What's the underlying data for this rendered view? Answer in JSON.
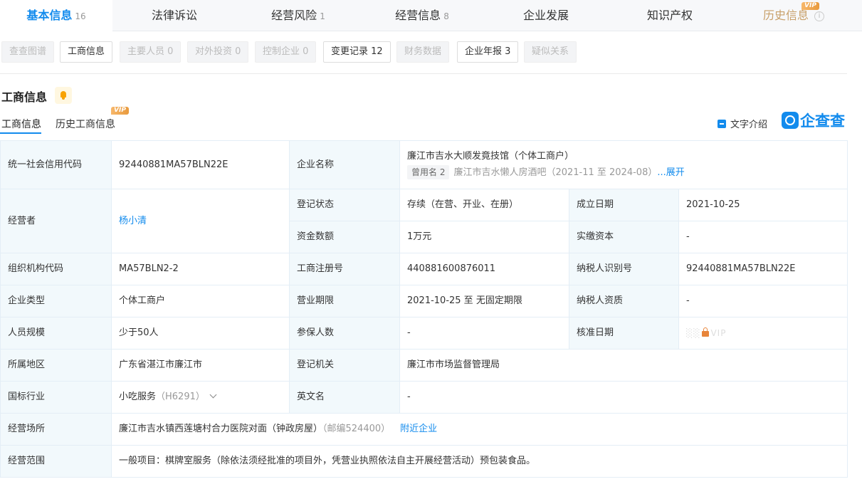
{
  "top_tabs": [
    {
      "label": "基本信息",
      "count": "16"
    },
    {
      "label": "法律诉讼",
      "count": ""
    },
    {
      "label": "经营风险",
      "count": "1"
    },
    {
      "label": "经营信息",
      "count": "8"
    },
    {
      "label": "企业发展",
      "count": ""
    },
    {
      "label": "知识产权",
      "count": ""
    },
    {
      "label": "历史信息",
      "count": ""
    }
  ],
  "vip_label": "VIP",
  "info_icon": "i",
  "sub_buttons": [
    {
      "label": "查查图谱"
    },
    {
      "label": "工商信息"
    },
    {
      "label": "主要人员 0"
    },
    {
      "label": "对外投资 0"
    },
    {
      "label": "控制企业 0"
    },
    {
      "label": "变更记录 12"
    },
    {
      "label": "财务数据"
    },
    {
      "label": "企业年报 3"
    },
    {
      "label": "疑似关系"
    }
  ],
  "section": {
    "title": "工商信息",
    "tab_current": "工商信息",
    "tab_history": "历史工商信息",
    "text_intro": "文字介绍",
    "brand": "企查查"
  },
  "table": {
    "credit_code_label": "统一社会信用代码",
    "credit_code": "92440881MA57BLN22E",
    "company_name_label": "企业名称",
    "company_name": "廉江市吉水大顺发竟技馆（个体工商户）",
    "former_name_tag": "曾用名 2",
    "former_name": "廉江市吉水懒人房酒吧（2021-11 至 2024-08）",
    "expand": "...展开",
    "operator_label": "经营者",
    "operator": "杨小清",
    "reg_status_label": "登记状态",
    "reg_status": "存续（在营、开业、在册）",
    "est_date_label": "成立日期",
    "est_date": "2021-10-25",
    "capital_label": "资金数额",
    "capital": "1万元",
    "paid_capital_label": "实缴资本",
    "paid_capital": "-",
    "org_code_label": "组织机构代码",
    "org_code": "MA57BLN2-2",
    "reg_no_label": "工商注册号",
    "reg_no": "440881600876011",
    "tax_id_label": "纳税人识别号",
    "tax_id": "92440881MA57BLN22E",
    "type_label": "企业类型",
    "type": "个体工商户",
    "term_label": "营业期限",
    "term": "2021-10-25 至 无固定期限",
    "tax_qual_label": "纳税人资质",
    "tax_qual": "-",
    "staff_label": "人员规模",
    "staff": "少于50人",
    "insured_label": "参保人数",
    "insured": "-",
    "approve_label": "核准日期",
    "approve_vip": "VIP",
    "region_label": "所属地区",
    "region": "广东省湛江市廉江市",
    "authority_label": "登记机关",
    "authority": "廉江市市场监督管理局",
    "industry_label": "国标行业",
    "industry": "小吃服务",
    "industry_code": "（H6291）",
    "english_label": "英文名",
    "english": "-",
    "address_label": "经营场所",
    "address": "廉江市吉水镇西莲塘村合力医院对面（钟政房屋）",
    "postcode": "（邮编524400）",
    "nearby": "附近企业",
    "scope_label": "经营范围",
    "scope": "一般项目：棋牌室服务（除依法须经批准的项目外，凭营业执照依法自主开展经营活动）预包装食品。"
  }
}
